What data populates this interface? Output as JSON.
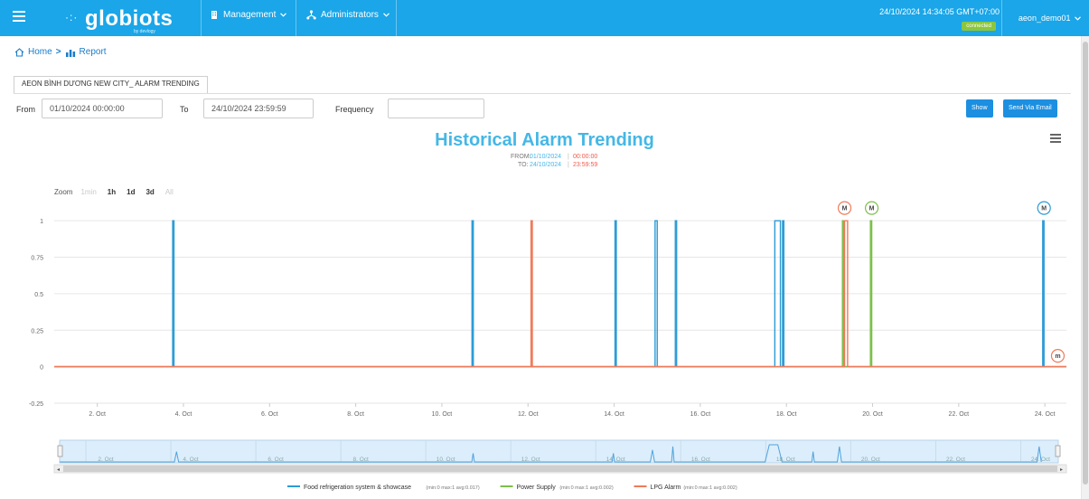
{
  "header": {
    "menu_icon": "hamburger-icon",
    "logo_text": "globiots",
    "logo_sub": "by devlogy",
    "nav": [
      {
        "label": "Management",
        "icon": "building-icon"
      },
      {
        "label": "Administrators",
        "icon": "network-icon"
      }
    ],
    "datetime": "24/10/2024 14:34:05 GMT+07:00",
    "status": "connected",
    "user": "aeon_demo01"
  },
  "breadcrumb": {
    "home": "Home",
    "separator": ">",
    "current": "Report"
  },
  "tab": {
    "label": "AEON BÌNH DƯƠNG NEW CITY_ ALARM TRENDING"
  },
  "filters": {
    "from_label": "From",
    "from_value": "01/10/2024 00:00:00",
    "to_label": "To",
    "to_value": "24/10/2024 23:59:59",
    "frequency_label": "Frequency",
    "frequency_value": "",
    "show_button": "Show",
    "email_button": "Send Via Email"
  },
  "chart_data": {
    "type": "line",
    "title": "Historical Alarm Trending",
    "subtitle_from_label": "FROM:",
    "subtitle_from_date": "01/10/2024",
    "subtitle_from_time": "00:00:00",
    "subtitle_to_label": "TO:",
    "subtitle_to_date": "24/10/2024",
    "subtitle_to_time": "23:59:59",
    "zoom_label": "Zoom",
    "zoom_options": [
      {
        "label": "1min",
        "enabled": false
      },
      {
        "label": "1h",
        "enabled": true
      },
      {
        "label": "1d",
        "enabled": true
      },
      {
        "label": "3d",
        "enabled": true
      },
      {
        "label": "All",
        "enabled": false
      }
    ],
    "x_range": [
      1.0,
      24.5
    ],
    "ylim": [
      -0.25,
      1.1
    ],
    "y_ticks": [
      -0.25,
      0,
      0.25,
      0.5,
      0.75,
      1
    ],
    "y_tick_labels": [
      "-0.25",
      "0",
      "0.25",
      "0.5",
      "0.75",
      "1"
    ],
    "x_ticks": [
      2,
      4,
      6,
      8,
      10,
      12,
      14,
      16,
      18,
      20,
      22,
      24
    ],
    "x_tick_labels": [
      "2. Oct",
      "4. Oct",
      "6. Oct",
      "8. Oct",
      "10. Oct",
      "12. Oct",
      "14. Oct",
      "16. Oct",
      "18. Oct",
      "20. Oct",
      "22. Oct",
      "24. Oct"
    ],
    "grid": true,
    "legend_position": "bottom",
    "series": [
      {
        "name": "Food refrigeration system & showcase",
        "stats": "(min:0 max:1 avg:0.017)",
        "color": "#2b9bd6",
        "pulses": [
          [
            3.75,
            3.78
          ],
          [
            10.7,
            10.73
          ],
          [
            14.02,
            14.05
          ],
          [
            14.95,
            15.0
          ],
          [
            15.42,
            15.45
          ],
          [
            17.73,
            17.86
          ],
          [
            17.91,
            17.94
          ],
          [
            23.95,
            23.98
          ]
        ]
      },
      {
        "name": "Power Supply",
        "stats": "(min:0 max:1 avg:0.002)",
        "color": "#7cbf4a",
        "pulses": [
          [
            19.3,
            19.33
          ],
          [
            19.95,
            19.98
          ]
        ]
      },
      {
        "name": "LPG Alarm",
        "stats": "(min:0 max:1 avg:0.002)",
        "color": "#f07a5a",
        "pulses": [
          [
            12.07,
            12.1
          ],
          [
            19.35,
            19.42
          ]
        ]
      }
    ],
    "markers": [
      {
        "label": "M",
        "x": 19.35,
        "y": 1,
        "color": "#f07a5a"
      },
      {
        "label": "M",
        "x": 19.98,
        "y": 1,
        "color": "#7cbf4a"
      },
      {
        "label": "M",
        "x": 23.98,
        "y": 1,
        "color": "#2b9bd6"
      },
      {
        "label": "m",
        "x": 24.3,
        "y": 0,
        "color": "#f07a5a"
      }
    ],
    "navigator_labels": [
      "2. Oct",
      "4. Oct",
      "6. Oct",
      "8. Oct",
      "10. Oct",
      "12. Oct",
      "14. Oct",
      "16. Oct",
      "18. Oct",
      "20. Oct",
      "22. Oct",
      "24. Oct"
    ],
    "navigator_values": [
      [
        1,
        0
      ],
      [
        3.7,
        0
      ],
      [
        3.75,
        0.6
      ],
      [
        3.8,
        0
      ],
      [
        10.7,
        0
      ],
      [
        10.73,
        0.5
      ],
      [
        10.76,
        0
      ],
      [
        14.0,
        0
      ],
      [
        14.03,
        0.5
      ],
      [
        14.06,
        0
      ],
      [
        14.9,
        0
      ],
      [
        14.95,
        0.7
      ],
      [
        15.0,
        0
      ],
      [
        15.4,
        0
      ],
      [
        15.43,
        0.9
      ],
      [
        15.46,
        0
      ],
      [
        17.6,
        0
      ],
      [
        17.7,
        1
      ],
      [
        17.9,
        1
      ],
      [
        18.0,
        0
      ],
      [
        18.7,
        0
      ],
      [
        18.73,
        0.6
      ],
      [
        18.76,
        0
      ],
      [
        19.3,
        0
      ],
      [
        19.35,
        0.9
      ],
      [
        19.4,
        0
      ],
      [
        24.0,
        0
      ],
      [
        24.05,
        0.9
      ],
      [
        24.1,
        0
      ]
    ]
  }
}
